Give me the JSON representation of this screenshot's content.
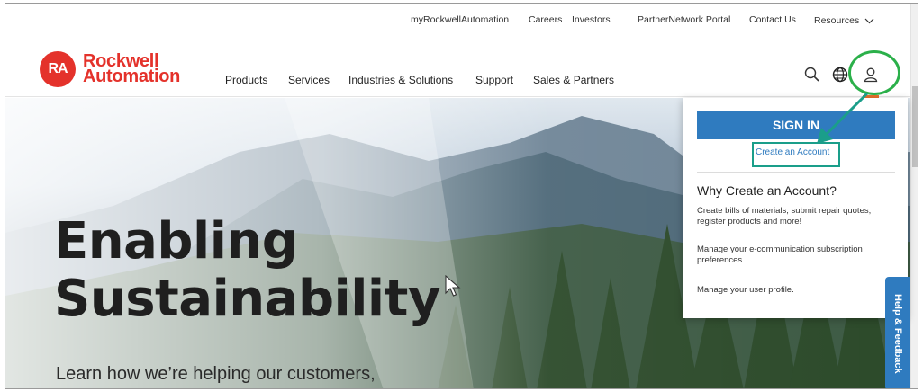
{
  "utility_nav": {
    "links": [
      "myRockwellAutomation",
      "Careers",
      "Investors",
      "PartnerNetwork Portal",
      "Contact Us"
    ],
    "resources_label": "Resources"
  },
  "brand": {
    "badge": "RA",
    "name_line1": "Rockwell",
    "name_line2": "Automation",
    "brand_color": "#e4322b"
  },
  "main_nav": {
    "items": [
      "Products",
      "Services",
      "Industries & Solutions",
      "Support",
      "Sales & Partners"
    ],
    "icons": [
      "search-icon",
      "globe-icon",
      "user-icon"
    ]
  },
  "hero": {
    "title_line1": "Enabling",
    "title_line2": "Sustainability",
    "subtitle": "Learn how we’re helping our customers,"
  },
  "account_dropdown": {
    "sign_in_label": "SIGN IN",
    "create_account_label": "Create an Account",
    "why_title": "Why Create an Account?",
    "paragraphs": [
      "Create bills of materials, submit repair quotes, register products and more!",
      "Manage your e-communication subscription preferences.",
      "Manage your user profile."
    ],
    "button_color": "#2f7bbf"
  },
  "feedback_tab": {
    "label": "Help & Feedback"
  },
  "annotation_colors": {
    "box": "#1a9e8a",
    "circle": "#2bb04a"
  }
}
